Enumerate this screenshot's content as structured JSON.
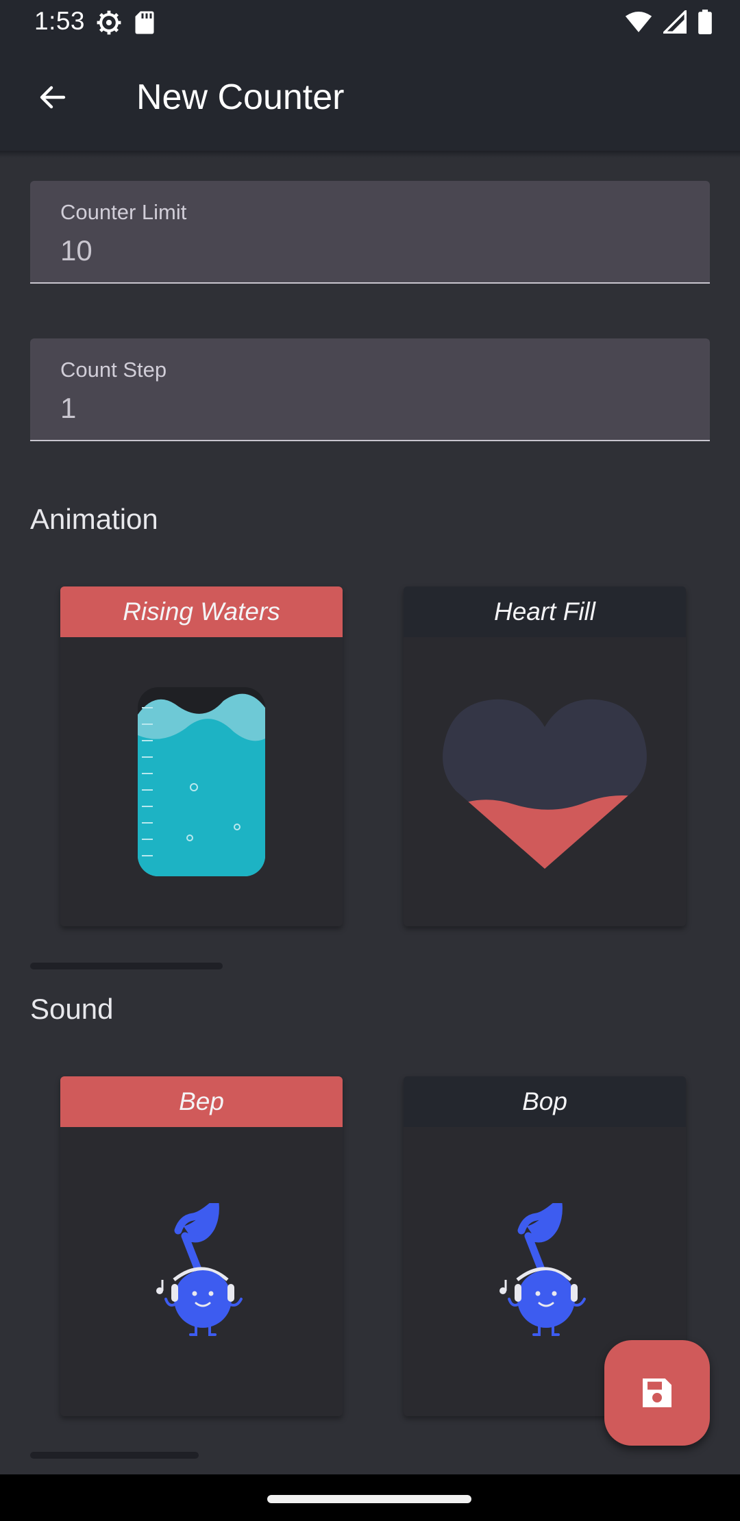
{
  "status_bar": {
    "time": "1:53",
    "left_icons": [
      "settings-icon",
      "sd-card-icon"
    ],
    "right_icons": [
      "wifi-icon",
      "signal-icon",
      "battery-icon"
    ]
  },
  "app_bar": {
    "title": "New Counter",
    "back_icon": "arrow-back-icon"
  },
  "form": {
    "counter_limit": {
      "label": "Counter Limit",
      "value": "10"
    },
    "count_step": {
      "label": "Count Step",
      "value": "1"
    }
  },
  "animation": {
    "title": "Animation",
    "options": [
      {
        "label": "Rising Waters",
        "selected": true,
        "icon": "rising-waters-illustration"
      },
      {
        "label": "Heart Fill",
        "selected": false,
        "icon": "heart-fill-illustration"
      }
    ]
  },
  "sound": {
    "title": "Sound",
    "options": [
      {
        "label": "Bep",
        "selected": true,
        "icon": "music-note-mascot-illustration"
      },
      {
        "label": "Bop",
        "selected": false,
        "icon": "music-note-mascot-illustration"
      }
    ]
  },
  "fab": {
    "icon": "save-icon"
  },
  "colors": {
    "accent": "#d05a5a",
    "background": "#2f3036",
    "app_bar": "#24272e",
    "water": "#1db3c4",
    "mascot": "#3d5cf0"
  }
}
